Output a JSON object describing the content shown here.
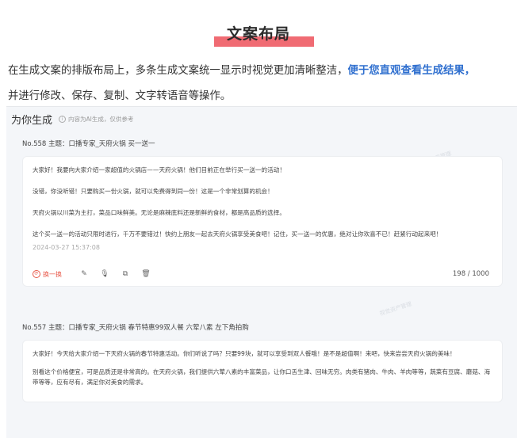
{
  "title": "文案布局",
  "intro": {
    "text_before": "在生成文案的排版布局上，多条生成文案统一显示时视觉更加清晰整洁，",
    "highlight": "便于您直观查看生成结果，",
    "text_after": "并进行修改、保存、复制、文字转语音等操作。"
  },
  "panel": {
    "title": "为你生成",
    "note": "内容为AI生成，仅供参考",
    "watermark": "视觉资产管理"
  },
  "records": [
    {
      "header": "No.558 主题：口播专家_天府火锅 买一送一",
      "paragraphs": [
        "大家好！我要向大家介绍一家超值的火锅店——天府火锅！他们目前正在举行买一送一的活动！",
        "没错，你没听错！只要购买一份火锅，就可以免费得到同一份！这是一个非常划算的机会！",
        "天府火锅以川菜为主打，菜品口味鲜美。无论是麻辣底料还是新鲜的食材，都是高品质的选择。",
        "这个买一送一的活动只限时进行，千万不要错过！快约上朋友一起去天府火锅享受美食吧！记住，买一送一的优惠，绝对让你欢喜不已！赶紧行动起来吧！"
      ],
      "date": "2024-03-27 15:37:08",
      "action_regen": "换一换",
      "count": "198 / 1000"
    },
    {
      "header": "No.557 主题：口播专家_天府火锅 春节特惠99双人餐 六荤八素 左下角拍购",
      "paragraphs": [
        "大家好！今天给大家介绍一下天府火锅的春节特惠活动。你们听说了吗？只要99块，就可以享受到双人餐哦！是不是超值啊！来吧，快来尝尝天府火锅的美味！",
        "别看这个价格便宜，可是品质还是非常高的。在天府火锅，我们提供六荤八素的丰富菜品，让你口舌生津、回味无穷。肉类有猪肉、牛肉、羊肉等等，蔬菜有豆腐、蘑菇、海带等等，应有尽有，满足你对美食的需求。"
      ]
    }
  ],
  "icons": {
    "regen": "refresh-icon",
    "edit": "edit-icon",
    "voice": "microphone-icon",
    "copy": "copy-icon",
    "delete": "trash-icon",
    "info": "info-icon"
  },
  "colors": {
    "highlight_text": "#2f6fcf",
    "title_marker": "#f06b73",
    "regen": "#e8594a"
  }
}
